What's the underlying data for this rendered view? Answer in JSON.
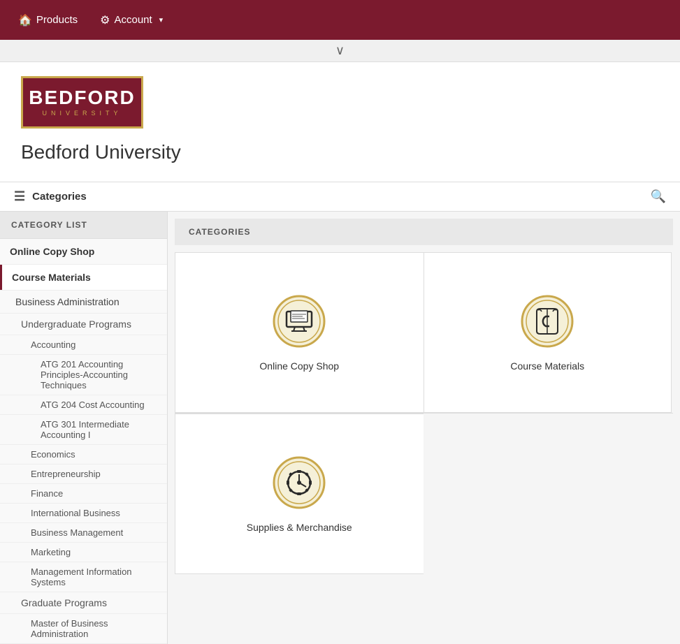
{
  "nav": {
    "products_label": "Products",
    "account_label": "Account",
    "products_icon": "🏠",
    "account_icon": "⚙"
  },
  "collapse_chevron": "∨",
  "logo": {
    "main": "BEDFORD",
    "sub": "UNIVERSITY"
  },
  "site_title": "Bedford University",
  "categories_bar": {
    "label": "Categories",
    "search_icon": "🔍"
  },
  "sidebar": {
    "header": "CATEGORY LIST",
    "items": [
      {
        "label": "Online Copy Shop",
        "level": 0
      },
      {
        "label": "Course Materials",
        "level": 0,
        "active": true
      },
      {
        "label": "Business Administration",
        "level": 1
      },
      {
        "label": "Undergraduate Programs",
        "level": 2
      },
      {
        "label": "Accounting",
        "level": 3
      },
      {
        "label": "ATG 201 Accounting Principles-Accounting Techniques",
        "level": 4
      },
      {
        "label": "ATG 204 Cost Accounting",
        "level": 4
      },
      {
        "label": "ATG 301 Intermediate Accounting I",
        "level": 4
      },
      {
        "label": "Economics",
        "level": 3
      },
      {
        "label": "Entrepreneurship",
        "level": 3
      },
      {
        "label": "Finance",
        "level": 3
      },
      {
        "label": "International Business",
        "level": 3
      },
      {
        "label": "Business Management",
        "level": 3
      },
      {
        "label": "Marketing",
        "level": 3
      },
      {
        "label": "Management Information Systems",
        "level": 3
      },
      {
        "label": "Graduate Programs",
        "level": 2
      },
      {
        "label": "Master of Business Administration",
        "level": 3
      }
    ]
  },
  "content": {
    "header": "CATEGORIES",
    "cards": [
      {
        "label": "Online Copy Shop",
        "icon": "copy-shop"
      },
      {
        "label": "Course Materials",
        "icon": "course-materials"
      },
      {
        "label": "Supplies & Merchandise",
        "icon": "supplies"
      }
    ]
  },
  "colors": {
    "brand": "#7b1a2e",
    "gold": "#c9a84c",
    "icon_bg": "#f5f0d0",
    "icon_ring": "#c9a84c"
  }
}
